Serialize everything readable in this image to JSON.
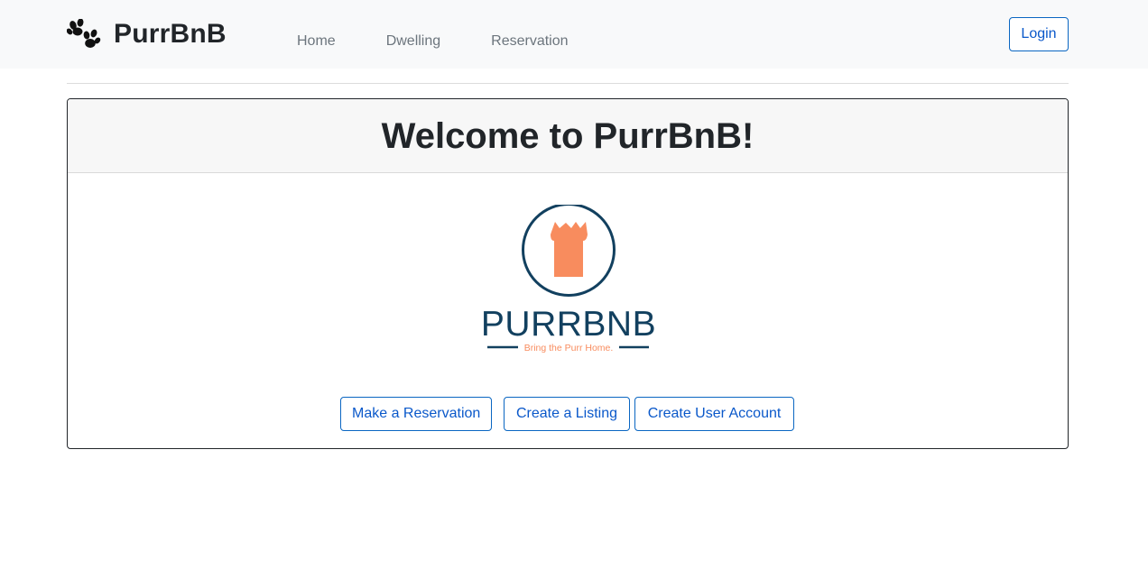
{
  "brand": {
    "name": "PurrBnB",
    "icon": "paw-icon"
  },
  "nav": {
    "items": [
      {
        "label": "Home"
      },
      {
        "label": "Dwelling"
      },
      {
        "label": "Reservation"
      }
    ],
    "login_label": "Login"
  },
  "card": {
    "title": "Welcome to PurrBnB!",
    "logo": {
      "wordmark": "PURRBNB",
      "tagline": "Bring the Purr Home."
    },
    "buttons": {
      "reserve": "Make a Reservation",
      "listing": "Create a Listing",
      "account": "Create User Account"
    }
  },
  "colors": {
    "accent": "#0a58ca",
    "logo_navy": "#12405f",
    "logo_orange": "#f88c5e",
    "navbar_bg": "#f8f9fa"
  }
}
